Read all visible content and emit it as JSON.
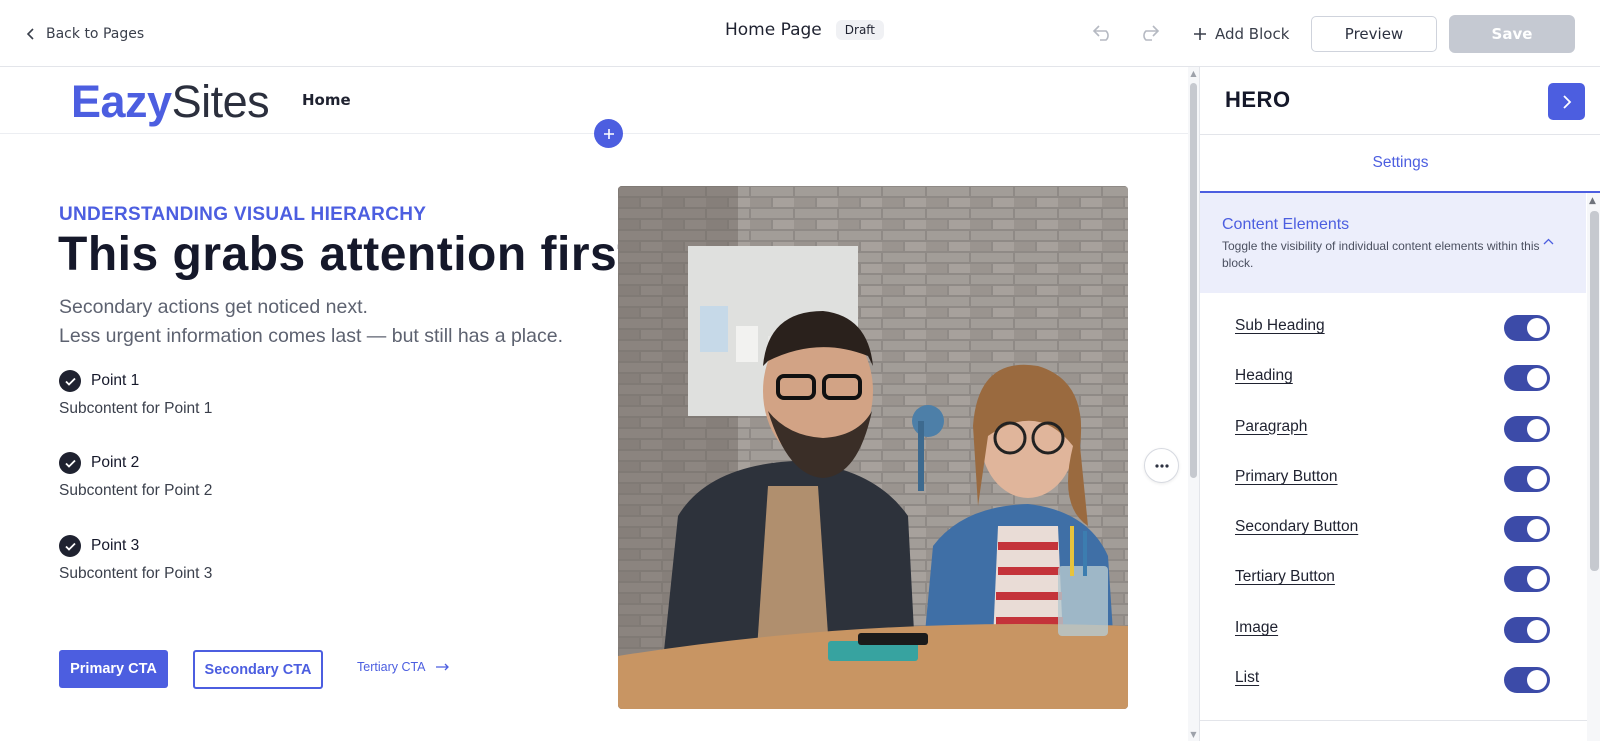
{
  "topbar": {
    "back_label": "Back to Pages",
    "page_title": "Home Page",
    "status_badge": "Draft",
    "add_block_label": "Add Block",
    "preview_label": "Preview",
    "save_label": "Save"
  },
  "site": {
    "logo_part1": "Eazy",
    "logo_part2": "Sites",
    "nav_home": "Home"
  },
  "hero": {
    "eyebrow": "UNDERSTANDING VISUAL HIERARCHY",
    "heading": "This grabs attention first",
    "paragraph_line1": "Secondary actions get noticed next.",
    "paragraph_line2": "Less urgent information comes last — but still has a place.",
    "points": [
      {
        "title": "Point 1",
        "sub": "Subcontent for Point 1"
      },
      {
        "title": "Point 2",
        "sub": "Subcontent for Point 2"
      },
      {
        "title": "Point 3",
        "sub": "Subcontent for Point 3"
      }
    ],
    "primary_cta": "Primary CTA",
    "secondary_cta": "Secondary CTA",
    "tertiary_cta": "Tertiary CTA"
  },
  "panel": {
    "title": "HERO",
    "tab_settings": "Settings",
    "section_title": "Content Elements",
    "section_desc": "Toggle the visibility of individual content elements within this block.",
    "elements": [
      {
        "label": "Sub Heading",
        "enabled": true
      },
      {
        "label": "Heading",
        "enabled": true
      },
      {
        "label": "Paragraph",
        "enabled": true
      },
      {
        "label": "Primary Button",
        "enabled": true
      },
      {
        "label": "Secondary Button",
        "enabled": true
      },
      {
        "label": "Tertiary Button",
        "enabled": true
      },
      {
        "label": "Image",
        "enabled": true
      },
      {
        "label": "List",
        "enabled": true
      }
    ]
  },
  "colors": {
    "accent": "#4c5ee0",
    "toggle_on": "#3c4ba8",
    "save_disabled": "#c5c9d2",
    "section_bg": "#eceefb"
  }
}
